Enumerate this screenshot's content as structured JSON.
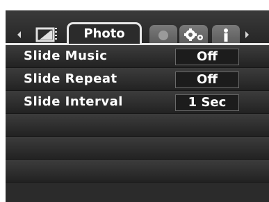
{
  "tabs": {
    "active_label": "Photo"
  },
  "menu": {
    "items": [
      {
        "label": "Slide Music",
        "value": "Off"
      },
      {
        "label": "Slide Repeat",
        "value": "Off"
      },
      {
        "label": "Slide Interval",
        "value": "1 Sec"
      }
    ]
  },
  "colors": {
    "background": "#2b2b2b",
    "highlight": "#e8e8e8",
    "inactive_tab": "#6b6b6b",
    "text": "#ffffff"
  },
  "icons": {
    "playback": "playback-mode-icon",
    "record": "record-icon",
    "settings": "settings-gears-icon",
    "info": "info-icon",
    "left": "tab-left-arrow-icon",
    "right": "tab-right-arrow-icon"
  }
}
